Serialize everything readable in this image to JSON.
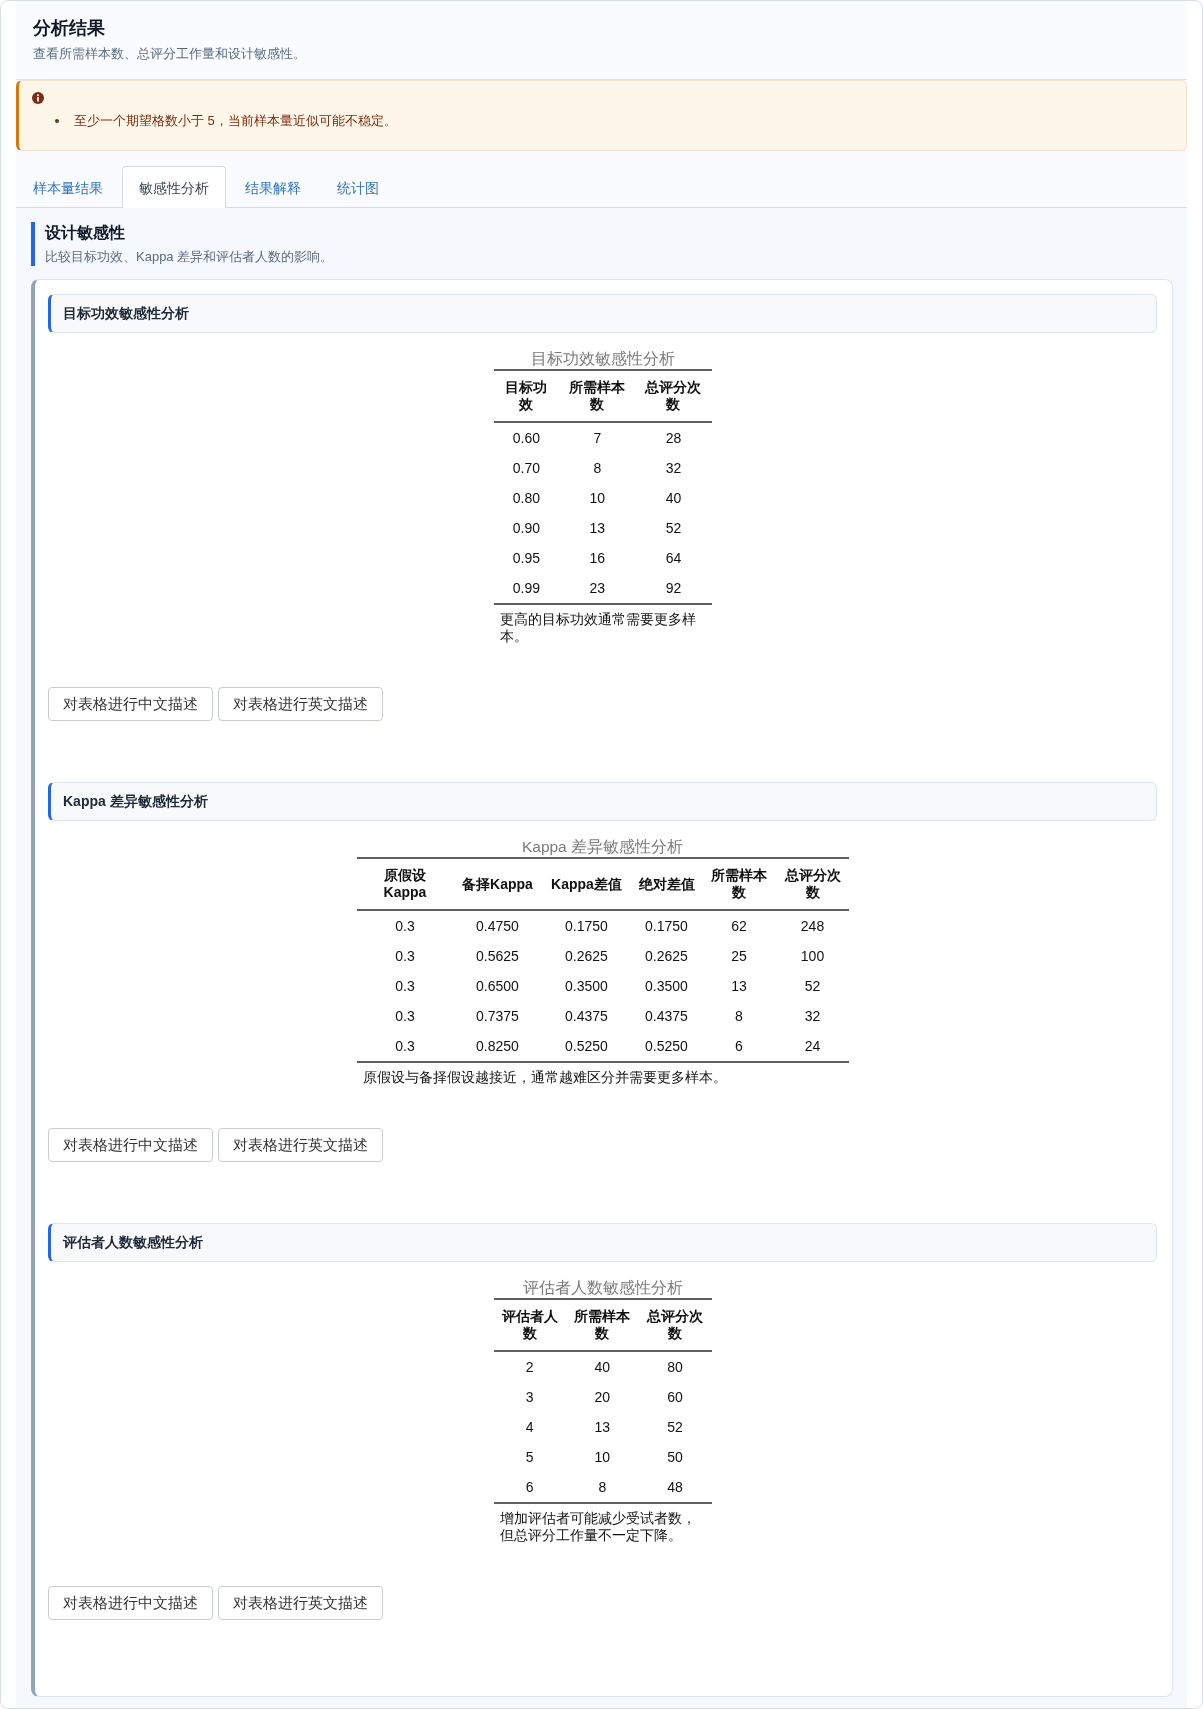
{
  "header": {
    "title": "分析结果",
    "subtitle": "查看所需样本数、总评分工作量和设计敏感性。"
  },
  "alert": {
    "kind": "warning",
    "items": [
      "至少一个期望格数小于 5，当前样本量近似可能不稳定。"
    ]
  },
  "tabs": [
    {
      "label": "样本量结果",
      "selected": false
    },
    {
      "label": "敏感性分析",
      "selected": true
    },
    {
      "label": "结果解释",
      "selected": false
    },
    {
      "label": "统计图",
      "selected": false
    }
  ],
  "panel": {
    "title": "设计敏感性",
    "subtitle": "比较目标功效、Kappa 差异和评估者人数的影响。",
    "sections": [
      {
        "heading": "目标功效敏感性分析",
        "table": {
          "caption": "目标功效敏感性分析",
          "columns": [
            "目标功效",
            "所需样本数",
            "总评分次数"
          ],
          "rows": [
            [
              "0.60",
              "7",
              "28"
            ],
            [
              "0.70",
              "8",
              "32"
            ],
            [
              "0.80",
              "10",
              "40"
            ],
            [
              "0.90",
              "13",
              "52"
            ],
            [
              "0.95",
              "16",
              "64"
            ],
            [
              "0.99",
              "23",
              "92"
            ]
          ],
          "note": "更高的目标功效通常需要更多样本。"
        },
        "buttons": [
          "对表格进行中文描述",
          "对表格进行英文描述"
        ]
      },
      {
        "heading": "Kappa 差异敏感性分析",
        "table": {
          "caption": "Kappa 差异敏感性分析",
          "columns": [
            "原假设Kappa",
            "备择Kappa",
            "Kappa差值",
            "绝对差值",
            "所需样本数",
            "总评分次数"
          ],
          "rows": [
            [
              "0.3",
              "0.4750",
              "0.1750",
              "0.1750",
              "62",
              "248"
            ],
            [
              "0.3",
              "0.5625",
              "0.2625",
              "0.2625",
              "25",
              "100"
            ],
            [
              "0.3",
              "0.6500",
              "0.3500",
              "0.3500",
              "13",
              "52"
            ],
            [
              "0.3",
              "0.7375",
              "0.4375",
              "0.4375",
              "8",
              "32"
            ],
            [
              "0.3",
              "0.8250",
              "0.5250",
              "0.5250",
              "6",
              "24"
            ]
          ],
          "note": "原假设与备择假设越接近，通常越难区分并需要更多样本。"
        },
        "buttons": [
          "对表格进行中文描述",
          "对表格进行英文描述"
        ]
      },
      {
        "heading": "评估者人数敏感性分析",
        "table": {
          "caption": "评估者人数敏感性分析",
          "columns": [
            "评估者人数",
            "所需样本数",
            "总评分次数"
          ],
          "rows": [
            [
              "2",
              "40",
              "80"
            ],
            [
              "3",
              "20",
              "60"
            ],
            [
              "4",
              "13",
              "52"
            ],
            [
              "5",
              "10",
              "50"
            ],
            [
              "6",
              "8",
              "48"
            ]
          ],
          "note": "增加评估者可能减少受试者数，但总评分工作量不一定下降。"
        },
        "buttons": [
          "对表格进行中文描述",
          "对表格进行英文描述"
        ]
      }
    ]
  }
}
